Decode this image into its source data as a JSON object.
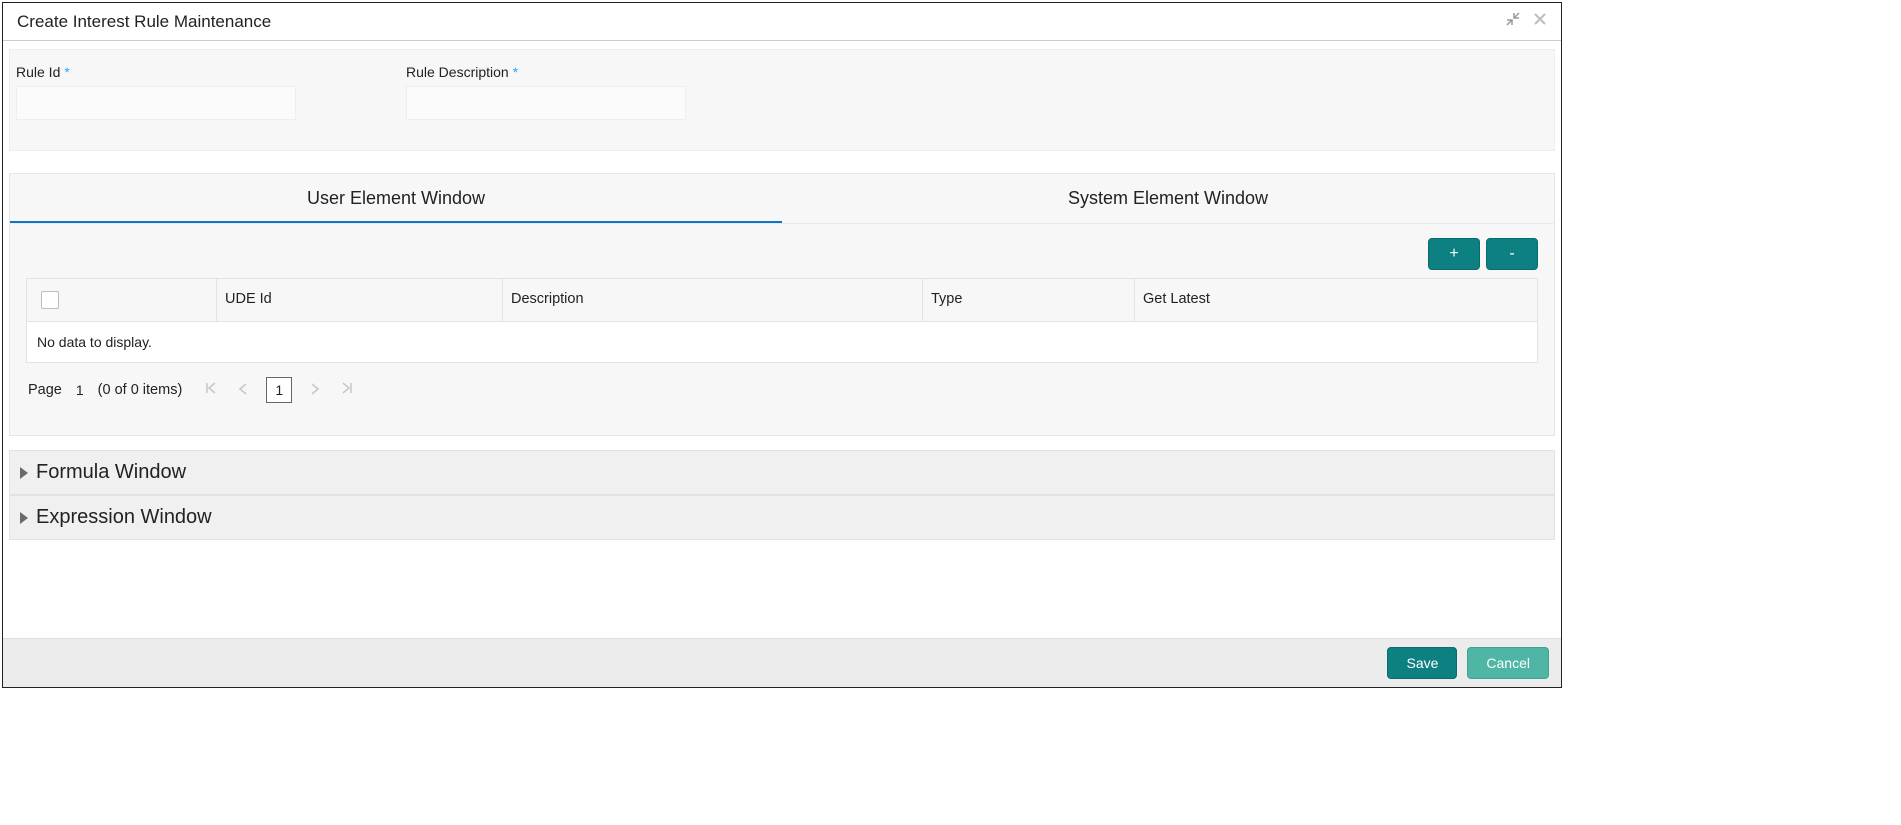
{
  "header": {
    "title": "Create Interest Rule Maintenance"
  },
  "form": {
    "rule_id_label": "Rule Id",
    "rule_id_value": "",
    "rule_desc_label": "Rule Description",
    "rule_desc_value": ""
  },
  "tabs": {
    "user": "User Element Window",
    "system": "System Element Window"
  },
  "grid": {
    "add_label": "+",
    "remove_label": "-",
    "columns": {
      "ude": "UDE Id",
      "description": "Description",
      "type": "Type",
      "get_latest": "Get Latest"
    },
    "empty": "No data to display."
  },
  "pager": {
    "page_label": "Page",
    "page_value": "1",
    "count_text": "(0 of 0 items)",
    "current_box": "1"
  },
  "sections": {
    "formula": "Formula Window",
    "expression": "Expression Window"
  },
  "footer": {
    "save": "Save",
    "cancel": "Cancel"
  }
}
